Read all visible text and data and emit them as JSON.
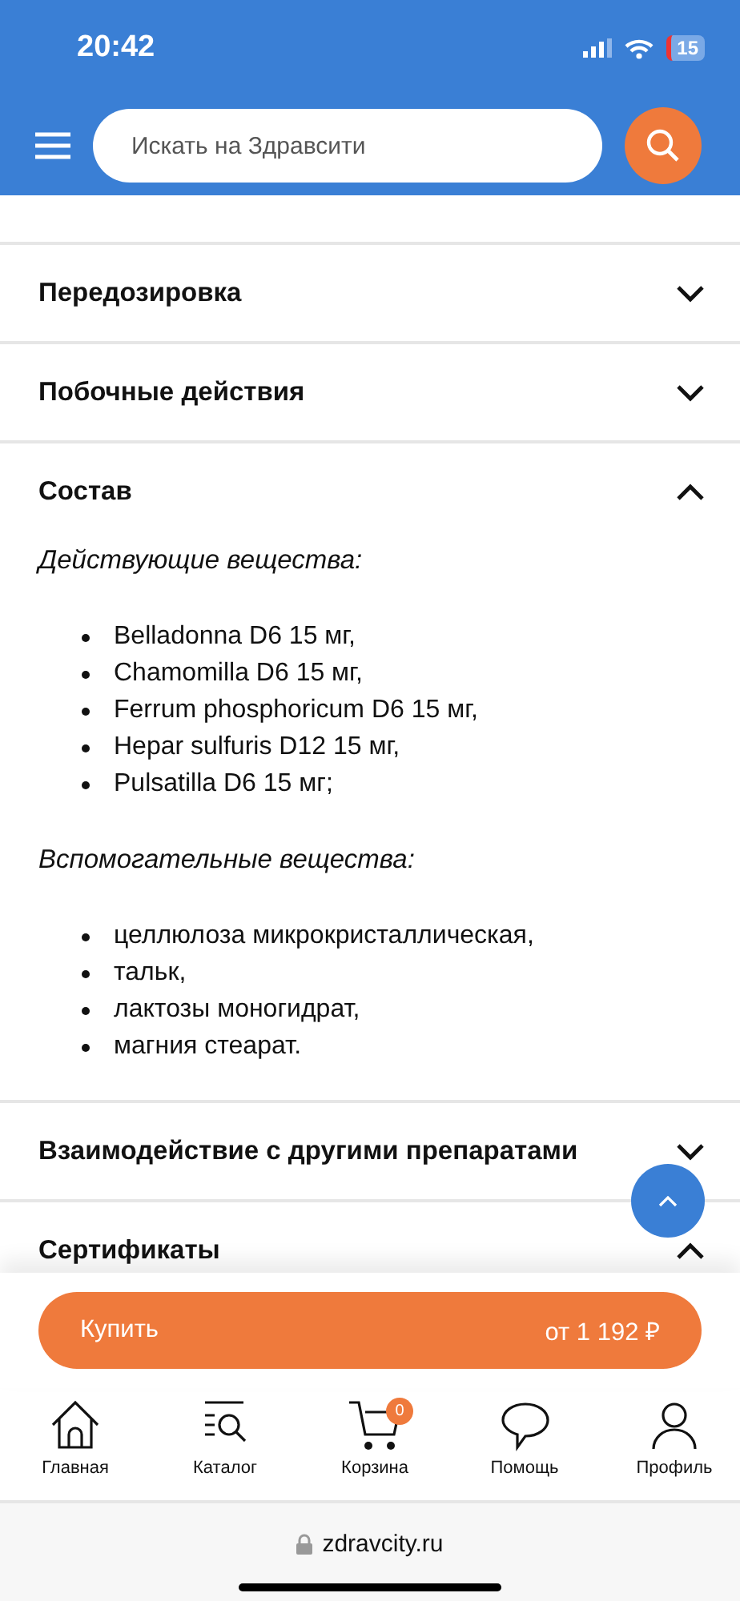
{
  "status_bar": {
    "time": "20:42",
    "battery": "15"
  },
  "header": {
    "search": {
      "placeholder": "Искать на Здравсити"
    }
  },
  "sections": [
    {
      "title": "Передозировка",
      "expanded": false
    },
    {
      "title": "Побочные действия",
      "expanded": false
    },
    {
      "title": "Состав",
      "expanded": true,
      "content": [
        {
          "heading": "Действующие вещества:",
          "items": [
            "Belladonna D6 15 мг,",
            "Chamomilla D6 15 мг,",
            "Ferrum phosphoricum D6 15 мг,",
            "Hepar sulfuris D12 15 мг,",
            "Pulsatilla D6 15 мг;"
          ]
        },
        {
          "heading": "Вспомогательные вещества:",
          "items": [
            "целлюлоза микрокристаллическая,",
            "тальк,",
            "лактозы моногидрат,",
            "магния стеарат."
          ]
        }
      ]
    },
    {
      "title": "Взаимодействие с другими препаратами",
      "expanded": false
    },
    {
      "title": "Сертификаты",
      "expanded": true
    }
  ],
  "buy": {
    "label": "Купить",
    "price": "от 1 192 ₽"
  },
  "tabs": [
    {
      "label": "Главная"
    },
    {
      "label": "Каталог"
    },
    {
      "label": "Корзина",
      "badge": "0"
    },
    {
      "label": "Помощь"
    },
    {
      "label": "Профиль"
    }
  ],
  "browser": {
    "url": "zdravcity.ru"
  }
}
